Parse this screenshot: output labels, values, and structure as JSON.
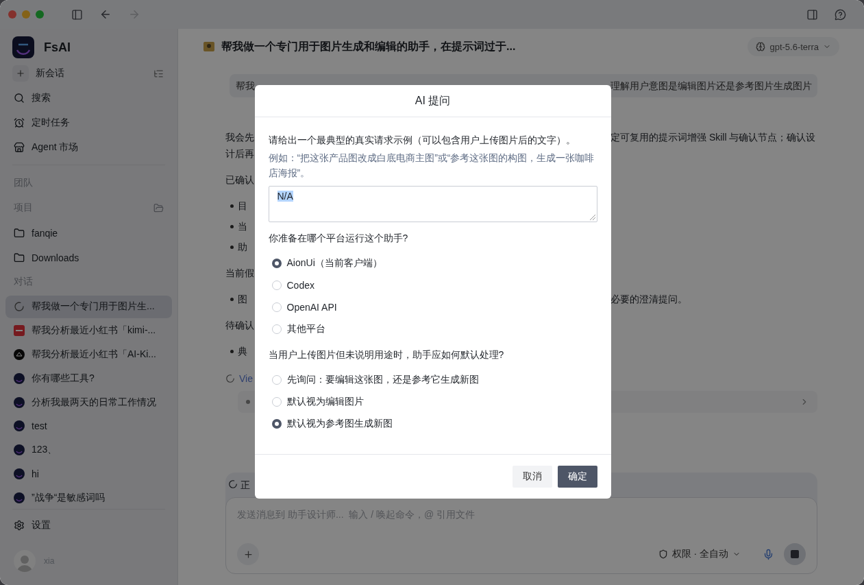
{
  "sidebar": {
    "app_name": "FsAI",
    "new_chat": "新会话",
    "nav": [
      {
        "kind": "search",
        "label": "搜索"
      },
      {
        "kind": "alarm",
        "label": "定时任务"
      },
      {
        "kind": "store",
        "label": "Agent 市场"
      }
    ],
    "team_heading": "团队",
    "projects_heading": "项目",
    "projects": [
      {
        "label": "fanqie"
      },
      {
        "label": "Downloads"
      }
    ],
    "chats_heading": "对话",
    "chats": [
      {
        "kind": "spinner",
        "label": "帮我做一个专门用于图片生...",
        "selected": true
      },
      {
        "kind": "note",
        "label": "帮我分析最近小红书「kimi-...",
        "selected": false
      },
      {
        "kind": "dark",
        "label": "帮我分析最近小红书「AI-Ki...",
        "selected": false
      },
      {
        "kind": "app",
        "label": "你有哪些工具?",
        "selected": false
      },
      {
        "kind": "app",
        "label": "分析我最两天的日常工作情况",
        "selected": false
      },
      {
        "kind": "app",
        "label": "test",
        "selected": false
      },
      {
        "kind": "app",
        "label": "123、",
        "selected": false
      },
      {
        "kind": "app",
        "label": "hi",
        "selected": false
      },
      {
        "kind": "app",
        "label": "”战争“是敏感词吗",
        "selected": false
      }
    ],
    "settings": "设置",
    "user": "xia"
  },
  "chat": {
    "title": "帮我做一个专门用于图片生成和编辑的助手，在提示词过于...",
    "model": "gpt-5.6-terra",
    "user_message": {
      "left": "帮我",
      "right": "理解用户意图是编辑图片还是参考图片生成图片"
    },
    "lines": [
      {
        "kind": "text",
        "left": "我会先",
        "right": "定可复用的提示词增强 Skill 与确认节点；确认设"
      },
      {
        "kind": "text",
        "left": "计后再"
      },
      {
        "kind": "heading",
        "left": "已确认"
      },
      {
        "kind": "bullet",
        "left": "目"
      },
      {
        "kind": "bullet",
        "left": "当"
      },
      {
        "kind": "bullet",
        "left": "助"
      },
      {
        "kind": "heading",
        "left": "当前假"
      },
      {
        "kind": "bullet",
        "left": "图",
        "right": "必要的澄清提问。"
      },
      {
        "kind": "heading",
        "left": "待确认"
      },
      {
        "kind": "bullet",
        "left": "典"
      }
    ],
    "view_link": "Vie",
    "status": "正",
    "input": {
      "placeholder": "发送消息到 助手设计师...  输入 / 唤起命令，@ 引用文件",
      "permission": "权限 · 全自动"
    }
  },
  "dialog": {
    "title": "AI 提问",
    "questions": [
      {
        "kind": "text",
        "prompt": "请给出一个最典型的真实请求示例（可以包含用户上传图片后的文字）。",
        "hint": "例如：“把这张产品图改成白底电商主图”或“参考这张图的构图，生成一张咖啡店海报”。",
        "value": "N/A"
      },
      {
        "kind": "choice",
        "prompt": "你准备在哪个平台运行这个助手?",
        "options": [
          {
            "label": "AionUi（当前客户端）",
            "selected": true
          },
          {
            "label": "Codex",
            "selected": false
          },
          {
            "label": "OpenAI API",
            "selected": false
          },
          {
            "label": "其他平台",
            "selected": false
          }
        ]
      },
      {
        "kind": "choice",
        "prompt": "当用户上传图片但未说明用途时，助手应如何默认处理?",
        "options": [
          {
            "label": "先询问：要编辑这张图，还是参考它生成新图",
            "selected": false
          },
          {
            "label": "默认视为编辑图片",
            "selected": false
          },
          {
            "label": "默认视为参考图生成新图",
            "selected": true
          }
        ]
      }
    ],
    "buttons": [
      {
        "kind": "secondary",
        "label": "取消"
      },
      {
        "kind": "primary",
        "label": "确定"
      }
    ]
  }
}
